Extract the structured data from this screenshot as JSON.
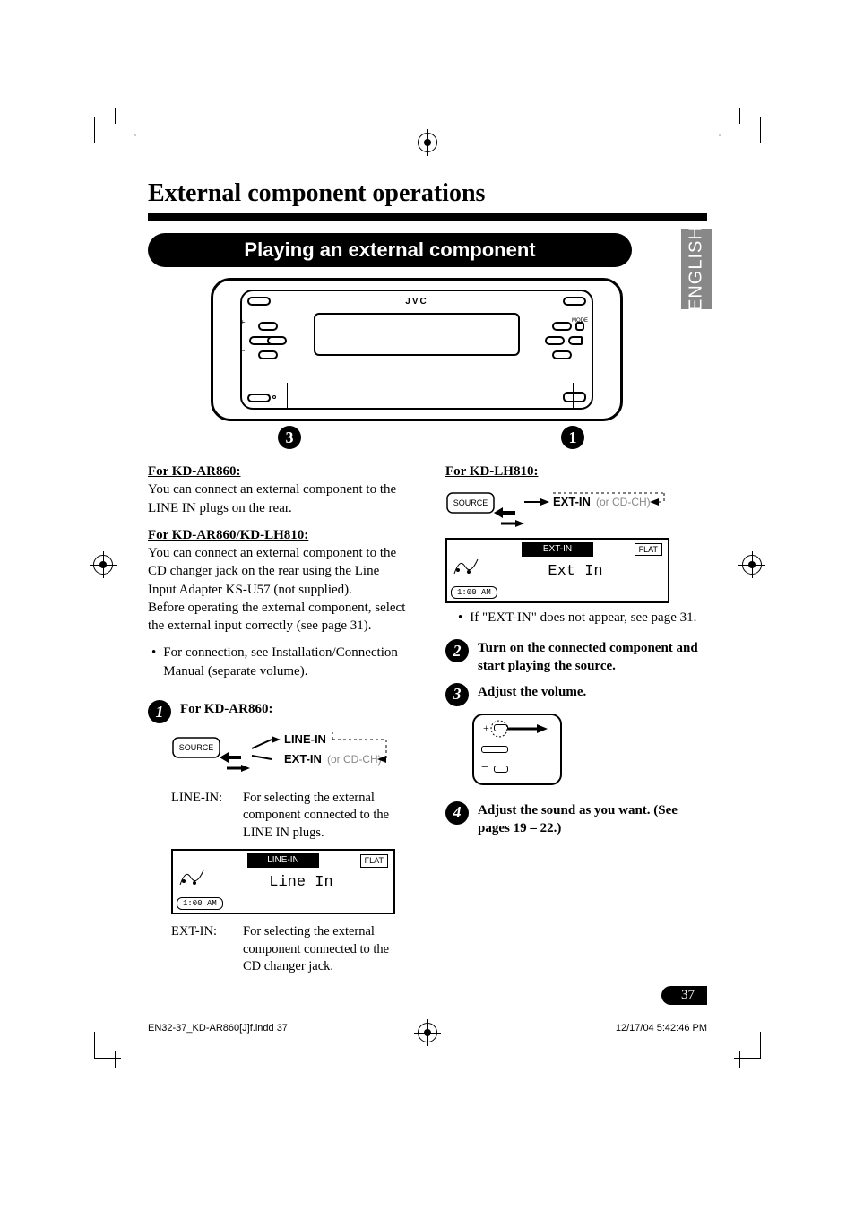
{
  "page": {
    "main_title": "External component operations",
    "subtitle": "Playing an external component",
    "language_tab": "ENGLISH",
    "page_number": "37"
  },
  "stereo": {
    "brand": "JVC",
    "mode_label": "MODE",
    "callout_left": "3",
    "callout_right": "1"
  },
  "left_col": {
    "h1": "For KD-AR860:",
    "p1": "You can connect an external component to the LINE IN plugs on the rear.",
    "h2": "For KD-AR860/KD-LH810:",
    "p2a": "You can connect an external component to the CD changer jack on the rear using the Line Input Adapter KS-U57 (not supplied).",
    "p2b": "Before operating the external component, select the external input correctly (see page 31).",
    "bullet1": "For connection, see Installation/Connection Manual (separate volume).",
    "step1_heading": "For KD-AR860:",
    "source_btn": "SOURCE",
    "line_in_label": "LINE-IN",
    "ext_in_label": "EXT-IN",
    "ext_in_grey": "(or CD-CH)",
    "def_line_in_lbl": "LINE-IN:",
    "def_line_in_txt": "For selecting the external component connected to the LINE IN plugs.",
    "lcd1_bar": "LINE-IN",
    "lcd1_flat": "FLAT",
    "lcd1_main": "Line In",
    "lcd1_time": "1:00  AM",
    "def_ext_in_lbl": "EXT-IN:",
    "def_ext_in_txt": "For selecting the external component connected to the CD changer jack."
  },
  "right_col": {
    "h1": "For KD-LH810:",
    "source_btn": "SOURCE",
    "ext_in_label": "EXT-IN",
    "ext_in_grey": "(or CD-CH)",
    "lcd2_bar": "EXT-IN",
    "lcd2_flat": "FLAT",
    "lcd2_main": "Ext In",
    "lcd2_time": "1:00  AM",
    "bullet1": "If \"EXT-IN\" does not appear, see page 31.",
    "step2": "Turn on the connected component and start playing the source.",
    "step3": "Adjust the volume.",
    "step4": "Adjust the sound as you want. (See pages 19 – 22.)"
  },
  "footer": {
    "left": "EN32-37_KD-AR860[J]f.indd   37",
    "right": "12/17/04   5:42:46 PM"
  },
  "crop_colors_left": [
    "#00aeef",
    "#ec008c",
    "#fff200",
    "#808285",
    "#000000",
    "#00a651",
    "#ed1c24",
    "#2e3192",
    "#ffffff"
  ],
  "crop_colors_right": [
    "#ffffff",
    "#d1d3d4",
    "#a7a9ac",
    "#808285",
    "#58595b",
    "#000000",
    "#000000",
    "#000000",
    "#000000"
  ]
}
